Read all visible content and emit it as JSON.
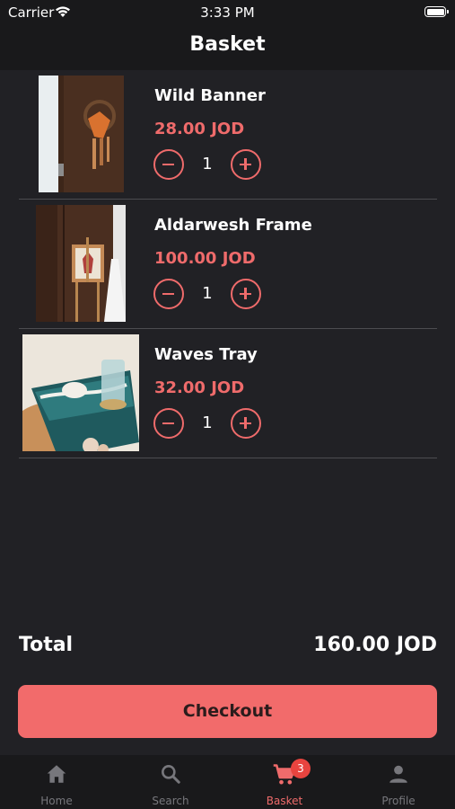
{
  "status_bar": {
    "carrier": "Carrier",
    "time": "3:33 PM"
  },
  "header": {
    "title": "Basket"
  },
  "basket": {
    "items": [
      {
        "name": "Wild Banner",
        "price": "28.00 JOD",
        "quantity": "1"
      },
      {
        "name": "Aldarwesh Frame",
        "price": "100.00 JOD",
        "quantity": "1"
      },
      {
        "name": "Waves Tray",
        "price": "32.00 JOD",
        "quantity": "1"
      }
    ]
  },
  "summary": {
    "total_label": "Total",
    "total_value": "160.00 JOD"
  },
  "checkout": {
    "label": "Checkout"
  },
  "tab_bar": {
    "tabs": [
      {
        "label": "Home",
        "icon": "home-icon"
      },
      {
        "label": "Search",
        "icon": "search-icon"
      },
      {
        "label": "Basket",
        "icon": "cart-icon",
        "badge": "3",
        "active": true
      },
      {
        "label": "Profile",
        "icon": "person-icon"
      }
    ]
  },
  "colors": {
    "accent": "#ef6b6b",
    "button": "#f26b6b",
    "badge": "#e8443f",
    "background": "#212125",
    "bars": "#19191b"
  }
}
